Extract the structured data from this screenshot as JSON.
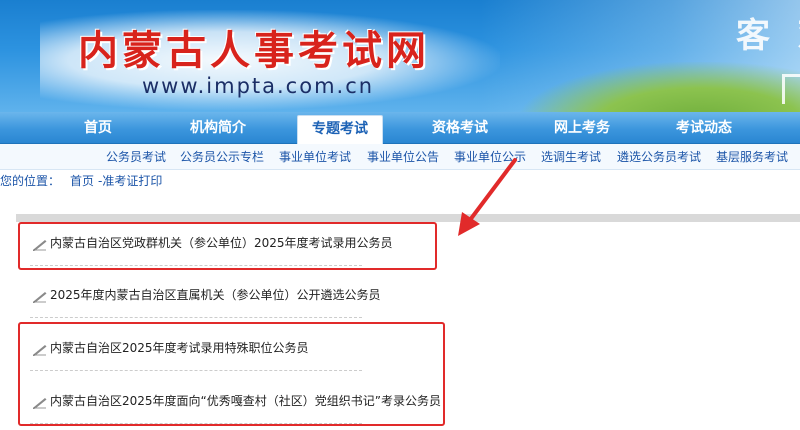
{
  "header": {
    "title": "内蒙古人事考试网",
    "url": "www.impta.com.cn",
    "slogan": "客 观"
  },
  "main_nav": [
    {
      "label": "首页"
    },
    {
      "label": "机构简介"
    },
    {
      "label": "专题考试",
      "active": true
    },
    {
      "label": "资格考试"
    },
    {
      "label": "网上考务"
    },
    {
      "label": "考试动态"
    }
  ],
  "sub_nav": [
    {
      "label": "公务员考试"
    },
    {
      "label": "公务员公示专栏"
    },
    {
      "label": "事业单位考试"
    },
    {
      "label": "事业单位公告"
    },
    {
      "label": "事业单位公示"
    },
    {
      "label": "选调生考试"
    },
    {
      "label": "遴选公务员考试"
    },
    {
      "label": "基层服务考试"
    }
  ],
  "breadcrumb": {
    "label": "您的位置：",
    "home": "首页",
    "current": "-准考证打印"
  },
  "list": [
    {
      "title": "内蒙古自治区党政群机关（参公单位）2025年度考试录用公务员",
      "highlighted": true
    },
    {
      "title": "2025年度内蒙古自治区直属机关（参公单位）公开遴选公务员",
      "highlighted": false
    },
    {
      "title": "内蒙古自治区2025年度考试录用特殊职位公务员",
      "highlighted": true
    },
    {
      "title": "内蒙古自治区2025年度面向“优秀嘎查村（社区）党组织书记”考录公务员",
      "highlighted": true
    }
  ],
  "colors": {
    "accent_blue": "#1c55a8",
    "annotation_red": "#e12a2a",
    "title_red": "#d8231c"
  },
  "icons": {
    "list_item": "pen-icon",
    "annotation": "red-arrow-icon"
  }
}
